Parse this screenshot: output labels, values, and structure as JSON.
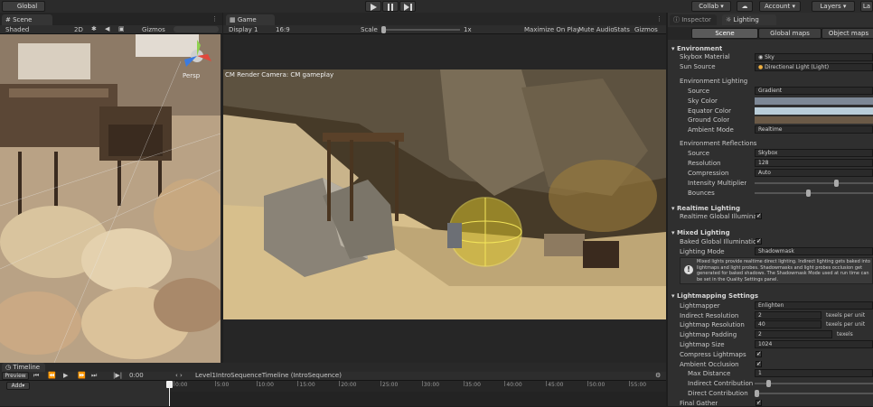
{
  "toolbar": {
    "global_label": "Global",
    "play_icon": "play-icon",
    "pause_icon": "pause-icon",
    "step_icon": "step-icon",
    "collab_label": "Collab",
    "account_label": "Account",
    "layers_label": "Layers",
    "layout_label": "La"
  },
  "scene": {
    "tab_label": "Scene",
    "shading_mode": "Shaded",
    "mode_2d": "2D",
    "gizmos_label": "Gizmos",
    "persp_label": "Persp"
  },
  "game": {
    "tab_label": "Game",
    "display": "Display 1",
    "aspect": "16:9",
    "scale_label": "Scale",
    "scale_value": "1x",
    "maximize_label": "Maximize On Play",
    "mute_label": "Mute Audio",
    "stats_label": "Stats",
    "gizmos_label": "Gizmos",
    "camera_overlay": "CM Render Camera: CM gameplay"
  },
  "inspector": {
    "tab_inspector": "Inspector",
    "tab_lighting": "Lighting",
    "subtabs": [
      "Scene",
      "Global maps",
      "Object maps"
    ],
    "environment": {
      "header": "Environment",
      "skybox_label": "Skybox Material",
      "skybox_value": "Sky",
      "sun_label": "Sun Source",
      "sun_value": "Directional Light (Light)",
      "lighting_header": "Environment Lighting",
      "source_label": "Source",
      "source_value": "Gradient",
      "sky_color_label": "Sky Color",
      "equator_label": "Equator Color",
      "ground_label": "Ground Color",
      "ambient_mode_label": "Ambient Mode",
      "ambient_mode_value": "Realtime",
      "sky_color": "#7d8896",
      "equator_color": "#b9cdd9",
      "ground_color": "#6b5a47",
      "reflections_header": "Environment Reflections",
      "refl_source_label": "Source",
      "refl_source_value": "Skybox",
      "resolution_label": "Resolution",
      "resolution_value": "128",
      "compression_label": "Compression",
      "compression_value": "Auto",
      "intensity_label": "Intensity Multiplier",
      "intensity_value": 0.7,
      "bounces_label": "Bounces",
      "bounces_value": 0.45
    },
    "realtime": {
      "header": "Realtime Lighting",
      "gi_label": "Realtime Global Illumination",
      "gi_checked": "✓"
    },
    "mixed": {
      "header": "Mixed Lighting",
      "baked_label": "Baked Global Illumination",
      "baked_checked": "✓",
      "mode_label": "Lighting Mode",
      "mode_value": "Shadowmask",
      "help_text": "Mixed lights provide realtime direct lighting. Indirect lighting gets baked into lightmaps and light probes. Shadowmasks and light probes occlusion get generated for baked shadows. The Shadowmask Mode used at run time can be set in the Quality Settings panel."
    },
    "lightmapping": {
      "header": "Lightmapping Settings",
      "lightmapper_label": "Lightmapper",
      "lightmapper_value": "Enlighten",
      "indirect_res_label": "Indirect Resolution",
      "indirect_res_value": "2",
      "indirect_res_unit": "texels per unit",
      "lightmap_res_label": "Lightmap Resolution",
      "lightmap_res_value": "40",
      "lightmap_res_unit": "texels per unit",
      "padding_label": "Lightmap Padding",
      "padding_value": "2",
      "padding_unit": "texels",
      "size_label": "Lightmap Size",
      "size_value": "1024",
      "compress_label": "Compress Lightmaps",
      "compress_checked": "✓",
      "ao_label": "Ambient Occlusion",
      "ao_checked": "✓",
      "max_dist_label": "Max Distance",
      "max_dist_value": "1",
      "indirect_contrib_label": "Indirect Contribution",
      "indirect_contrib_value": 0.1,
      "direct_contrib_label": "Direct Contribution",
      "direct_contrib_value": 0.0,
      "final_gather_label": "Final Gather",
      "final_gather_checked": "✓"
    }
  },
  "timeline": {
    "tab_label": "Timeline",
    "preview_label": "Preview",
    "time_value": "0:00",
    "asset_name": "Level1IntroSequenceTimeline (IntroSequence)",
    "add_label": "Add",
    "ticks": [
      "0:00",
      "5:00",
      "10:00",
      "15:00",
      "20:00",
      "25:00",
      "30:00",
      "35:00",
      "40:00",
      "45:00",
      "50:00",
      "55:00"
    ]
  }
}
